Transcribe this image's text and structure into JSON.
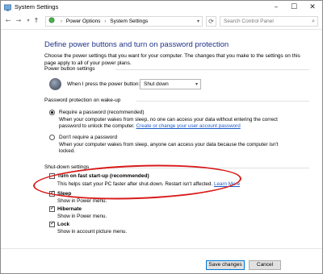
{
  "window": {
    "title": "System Settings"
  },
  "titlebar": {
    "minimize": "–",
    "maximize": "☐",
    "close": "✕"
  },
  "nav": {
    "back": "←",
    "forward": "→",
    "recent": "▾",
    "up": "↑",
    "refresh": "⟳"
  },
  "address": {
    "crumbs": [
      "Power Options",
      "System Settings"
    ],
    "separator": "›",
    "dropdown": "▾"
  },
  "search": {
    "placeholder": "Search Control Panel",
    "icon": "⌕"
  },
  "page": {
    "heading": "Define power buttons and turn on password protection",
    "intro": "Choose the power settings that you want for your computer. The changes that you make to the settings on this page apply to all of your power plans."
  },
  "power_button": {
    "section_title": "Power button settings",
    "label": "When I press the power button:",
    "selected": "Shut down",
    "arrow": "▾"
  },
  "password": {
    "section_title": "Password protection on wake-up",
    "options": [
      {
        "label": "Require a password (recommended)",
        "desc_line1": "When your computer wakes from sleep, no one can access your data without entering the correct",
        "desc_line2": "password to unlock the computer.",
        "link": "Create or change your user account password",
        "checked": true
      },
      {
        "label": "Don't require a password",
        "desc_line1": "When your computer wakes from sleep, anyone can access your data because the computer isn't",
        "desc_line2": "locked.",
        "checked": false
      }
    ]
  },
  "shutdown": {
    "section_title": "Shut-down settings",
    "items": [
      {
        "label": "Turn on fast start-up (recommended)",
        "desc": "This helps start your PC faster after shut-down. Restart isn't affected.",
        "link": "Learn More",
        "checked": false
      },
      {
        "label": "Sleep",
        "desc": "Show in Power menu.",
        "checked": true
      },
      {
        "label": "Hibernate",
        "desc": "Show in Power menu.",
        "checked": true
      },
      {
        "label": "Lock",
        "desc": "Show in account picture menu.",
        "checked": true
      }
    ]
  },
  "buttons": {
    "save": "Save changes",
    "cancel": "Cancel"
  },
  "colors": {
    "heading": "#1e3287",
    "link": "#1a5ac8",
    "annotation": "#d91a1a"
  }
}
